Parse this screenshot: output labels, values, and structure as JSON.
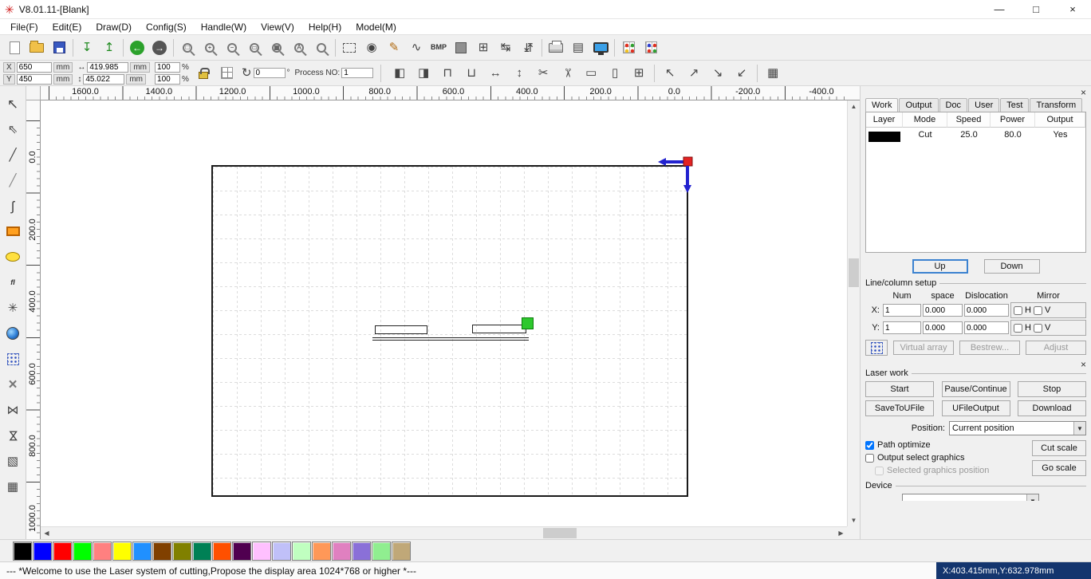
{
  "title_bar": {
    "title": "V8.01.11-[Blank]",
    "minimize_glyph": "—",
    "maximize_glyph": "□",
    "close_glyph": "×"
  },
  "menu": {
    "items": [
      {
        "label": "File(F)"
      },
      {
        "label": "Edit(E)"
      },
      {
        "label": "Draw(D)"
      },
      {
        "label": "Config(S)"
      },
      {
        "label": "Handle(W)"
      },
      {
        "label": "View(V)"
      },
      {
        "label": "Help(H)"
      },
      {
        "label": "Model(M)"
      }
    ]
  },
  "toolbar1": {
    "items": [
      {
        "name": "new-icon",
        "kind": "page"
      },
      {
        "name": "open-icon",
        "kind": "folder"
      },
      {
        "name": "save-icon",
        "kind": "floppy"
      },
      {
        "sep": true
      },
      {
        "name": "import-icon",
        "glyph": "↧",
        "color": "#1f8a1f"
      },
      {
        "name": "export-icon",
        "glyph": "↥",
        "color": "#1f8a1f"
      },
      {
        "sep": true
      },
      {
        "name": "undo-icon",
        "kind": "circ-green",
        "glyph": "←"
      },
      {
        "name": "redo-icon",
        "kind": "circ-dark",
        "glyph": "→"
      },
      {
        "sep": true
      },
      {
        "name": "zoom-window-icon",
        "kind": "mag",
        "glyph": "□"
      },
      {
        "name": "zoom-in-icon",
        "kind": "mag",
        "glyph": "+"
      },
      {
        "name": "zoom-out-icon",
        "kind": "mag",
        "glyph": "−"
      },
      {
        "name": "zoom-page-icon",
        "kind": "mag",
        "glyph": "▭"
      },
      {
        "name": "zoom-all-icon",
        "kind": "mag",
        "glyph": "▦"
      },
      {
        "name": "zoom-text-icon",
        "kind": "mag",
        "glyph": "A"
      },
      {
        "name": "zoom-view-icon",
        "kind": "mag",
        "glyph": ""
      },
      {
        "sep": true
      },
      {
        "name": "select-frame-icon",
        "kind": "dashrect"
      },
      {
        "name": "pick-coordinate-icon",
        "glyph": "◉"
      },
      {
        "name": "pen-icon",
        "glyph": "✎",
        "color": "#b06a10"
      },
      {
        "name": "curve-icon",
        "glyph": "∿"
      },
      {
        "name": "bmp-icon",
        "kind": "textlabel",
        "glyph": "BMP"
      },
      {
        "name": "fill-icon",
        "kind": "square-gray"
      },
      {
        "name": "copies-icon",
        "glyph": "⊞"
      },
      {
        "name": "measure-width-icon",
        "glyph": "↹"
      },
      {
        "name": "measure-height-icon",
        "glyph": "↹",
        "cls": "rot90"
      },
      {
        "sep": true
      },
      {
        "name": "print-icon",
        "kind": "printer"
      },
      {
        "name": "preview-icon",
        "glyph": "▤"
      },
      {
        "name": "monitor-icon",
        "kind": "monitor"
      },
      {
        "sep": true
      },
      {
        "name": "output-array-icon",
        "kind": "gridc"
      },
      {
        "name": "output-array-config-icon",
        "kind": "gridc2"
      }
    ]
  },
  "toolbar2": {
    "x_label": "X",
    "y_label": "Y",
    "x_value": "650",
    "y_value": "450",
    "unit": "mm",
    "width_icon_glyph": "↔",
    "height_icon_glyph": "↕",
    "width_value": "419.985",
    "height_value": "45.022",
    "scale_x_value": "100",
    "scale_y_value": "100",
    "percent": "%",
    "rotate_glyph": "↻",
    "rotate_value": "0",
    "degree_label": "°",
    "process_label": "Process NO:",
    "process_value": "1",
    "icons": [
      {
        "name": "mirror-horizontal-icon",
        "glyph": "◧"
      },
      {
        "name": "mirror-vertical-icon",
        "glyph": "◨"
      },
      {
        "name": "align-top-icon",
        "glyph": "⊓"
      },
      {
        "name": "align-bottom-icon",
        "glyph": "⊔"
      },
      {
        "name": "expand-horizontal-icon",
        "glyph": "↔"
      },
      {
        "name": "expand-vertical-icon",
        "glyph": "↕"
      },
      {
        "name": "cut-horizontal-icon",
        "glyph": "✂"
      },
      {
        "name": "cut-vertical-icon",
        "glyph": "✂",
        "cls": "rot90"
      },
      {
        "name": "width-size-icon",
        "glyph": "▭"
      },
      {
        "name": "height-size-icon",
        "glyph": "▯"
      },
      {
        "name": "array-copy-icon",
        "glyph": "⊞"
      },
      {
        "sep": true
      },
      {
        "name": "anchor-top-left-icon",
        "glyph": "↖"
      },
      {
        "name": "anchor-top-right-icon",
        "glyph": "↗"
      },
      {
        "name": "anchor-bottom-right-icon",
        "glyph": "↘"
      },
      {
        "name": "anchor-bottom-left-icon",
        "glyph": "↙"
      },
      {
        "sep": true
      },
      {
        "name": "table-icon",
        "glyph": "▦"
      }
    ]
  },
  "left_toolbar": {
    "items": [
      {
        "name": "select-tool",
        "glyph": "↖",
        "cls": "big"
      },
      {
        "name": "node-edit-tool",
        "glyph": "⇖"
      },
      {
        "name": "line-tool",
        "glyph": "╱"
      },
      {
        "name": "polyline-tool",
        "glyph": "╱",
        "color": "#888888"
      },
      {
        "name": "curve-tool",
        "glyph": "ʃ",
        "cls": "big"
      },
      {
        "name": "rectangle-tool",
        "kind": "box-orange"
      },
      {
        "name": "ellipse-tool",
        "kind": "oval-yellow"
      },
      {
        "name": "text-tool",
        "kind": "textlabel",
        "glyph": "fI",
        "cls": "txtt"
      },
      {
        "name": "polygon-tool",
        "glyph": "✳"
      },
      {
        "name": "bitmap-tool",
        "kind": "ball"
      },
      {
        "name": "dot-matrix-tool",
        "kind": "dotgrid"
      },
      {
        "name": "delete-tool",
        "glyph": "×",
        "cls": "del"
      },
      {
        "name": "mirror-horizontal-tool",
        "glyph": "⋈"
      },
      {
        "name": "mirror-vertical-tool",
        "glyph": "⋈",
        "cls": "rot90"
      },
      {
        "name": "preview-tool",
        "glyph": "▧"
      },
      {
        "name": "array-tool",
        "glyph": "▦"
      }
    ]
  },
  "rulers": {
    "horizontal": [
      "1600.0",
      "1400.0",
      "1200.0",
      "1000.0",
      "800.0",
      "600.0",
      "400.0",
      "200.0",
      "0.0",
      "-200.0",
      "-400.0"
    ],
    "vertical": [
      "0.0",
      "200.0",
      "400.0",
      "600.0",
      "800.0",
      "1000.0"
    ]
  },
  "canvas": {
    "origin_arrow_color": "#2222cf",
    "origin_square_color": "#e32222",
    "selection_handle_color": "#2ec82e"
  },
  "right_panel": {
    "close_glyph": "×",
    "tabs": [
      "Work",
      "Output",
      "Doc",
      "User",
      "Test",
      "Transform"
    ],
    "active_tab_index": 0,
    "layer_table": {
      "headers": [
        "Layer",
        "Mode",
        "Speed",
        "Power",
        "Output"
      ],
      "rows": [
        {
          "color": "#000000",
          "mode": "Cut",
          "speed": "25.0",
          "power": "80.0",
          "output": "Yes"
        }
      ]
    },
    "up_label": "Up",
    "down_label": "Down",
    "line_column": {
      "title": "Line/column setup",
      "col_headers": [
        "Num",
        "space",
        "Dislocation",
        "Mirror"
      ],
      "x_label": "X:",
      "y_label": "Y:",
      "h_label": "H",
      "v_label": "V",
      "x": {
        "num": "1",
        "space": "0.000",
        "dislocation": "0.000"
      },
      "y": {
        "num": "1",
        "space": "0.000",
        "dislocation": "0.000"
      },
      "buttons": [
        {
          "label": "Virtual array",
          "disabled": true
        },
        {
          "label": "Bestrew...",
          "disabled": true
        },
        {
          "label": "Adjust",
          "disabled": true
        }
      ]
    },
    "laser_work": {
      "title": "Laser work",
      "buttons_row1": [
        "Start",
        "Pause/Continue",
        "Stop"
      ],
      "buttons_row2": [
        "SaveToUFile",
        "UFileOutput",
        "Download"
      ],
      "position_label": "Position:",
      "position_value": "Current position",
      "checkboxes": [
        {
          "label": "Path optimize",
          "checked": true
        },
        {
          "label": "Output select graphics",
          "checked": false
        },
        {
          "label": "Selected graphics position",
          "checked": false,
          "disabled": true
        }
      ],
      "cut_scale_label": "Cut scale",
      "go_scale_label": "Go scale"
    },
    "device": {
      "title": "Device"
    }
  },
  "palette": {
    "colors": [
      "#000000",
      "#0000ff",
      "#ff0000",
      "#00ff00",
      "#ff8080",
      "#ffff00",
      "#2090ff",
      "#804000",
      "#808000",
      "#008055",
      "#ff5000",
      "#500050",
      "#ffc0ff",
      "#c0c0f8",
      "#c0ffc0",
      "#ff9858",
      "#e080c0",
      "#8a70d8",
      "#90ee90",
      "#c0a878"
    ]
  },
  "status_bar": {
    "message": "--- *Welcome to use the Laser system of cutting,Propose the display area 1024*768 or higher *---",
    "coords": "X:403.415mm,Y:632.978mm",
    "coords_bg": "#14356e"
  }
}
